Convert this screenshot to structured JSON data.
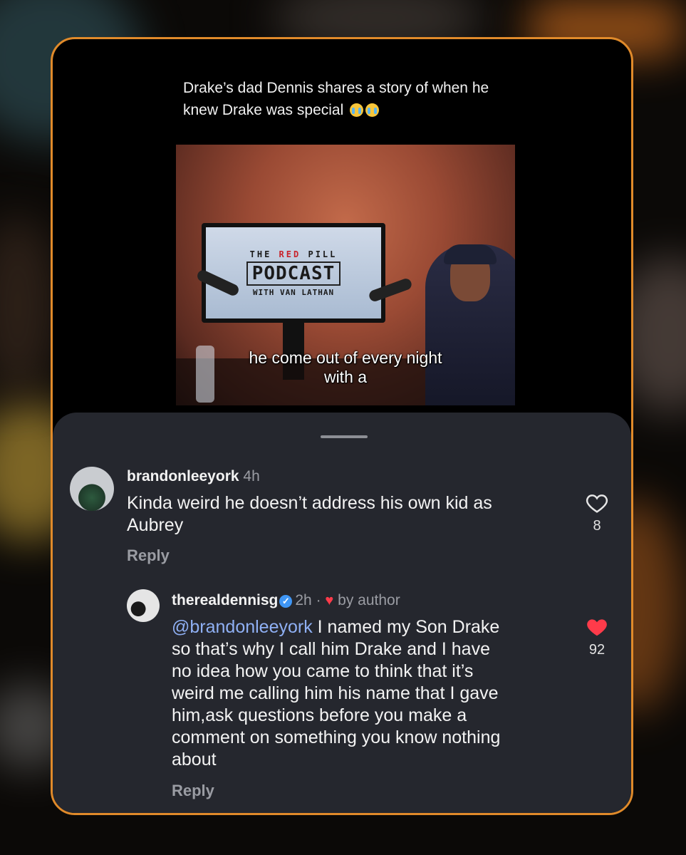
{
  "post": {
    "caption_line1": "Drake’s dad Dennis shares a story of when he",
    "caption_line2": "knew Drake was special"
  },
  "video": {
    "tv_line1_a": "THE",
    "tv_line1_red": "RED",
    "tv_line1_b": "PILL",
    "tv_line2": "PODCAST",
    "tv_line3": "WITH VAN LATHAN",
    "subtitle_line1": "he come out of every night",
    "subtitle_line2": "with a"
  },
  "comments": [
    {
      "username": "brandonleeyork",
      "time": "4h",
      "text_line1": "Kinda weird he doesn’t address his own kid as",
      "text_line2": "Aubrey",
      "reply_label": "Reply",
      "like_count": "8",
      "liked": false
    }
  ],
  "reply": {
    "username": "therealdennisg",
    "time": "2h",
    "separator": "·",
    "by_author": "by author",
    "mention": "@brandonleeyork",
    "text_line1": " I named my Son Drake",
    "text_line2": "so that’s why I call him Drake and I have",
    "text_line3": "no idea how you came to think that it’s",
    "text_line4": "weird me calling him his name that I gave",
    "text_line5": "him,ask questions before you make a",
    "text_line6": "comment on something you know nothing",
    "text_line7": "about",
    "reply_label": "Reply",
    "like_count": "92",
    "liked": true
  },
  "colors": {
    "card_border": "#e08a2a",
    "sheet_bg": "#25272e",
    "mention": "#8fb0f4",
    "like_red": "#ff3b4a",
    "verified_blue": "#3f96f5"
  }
}
